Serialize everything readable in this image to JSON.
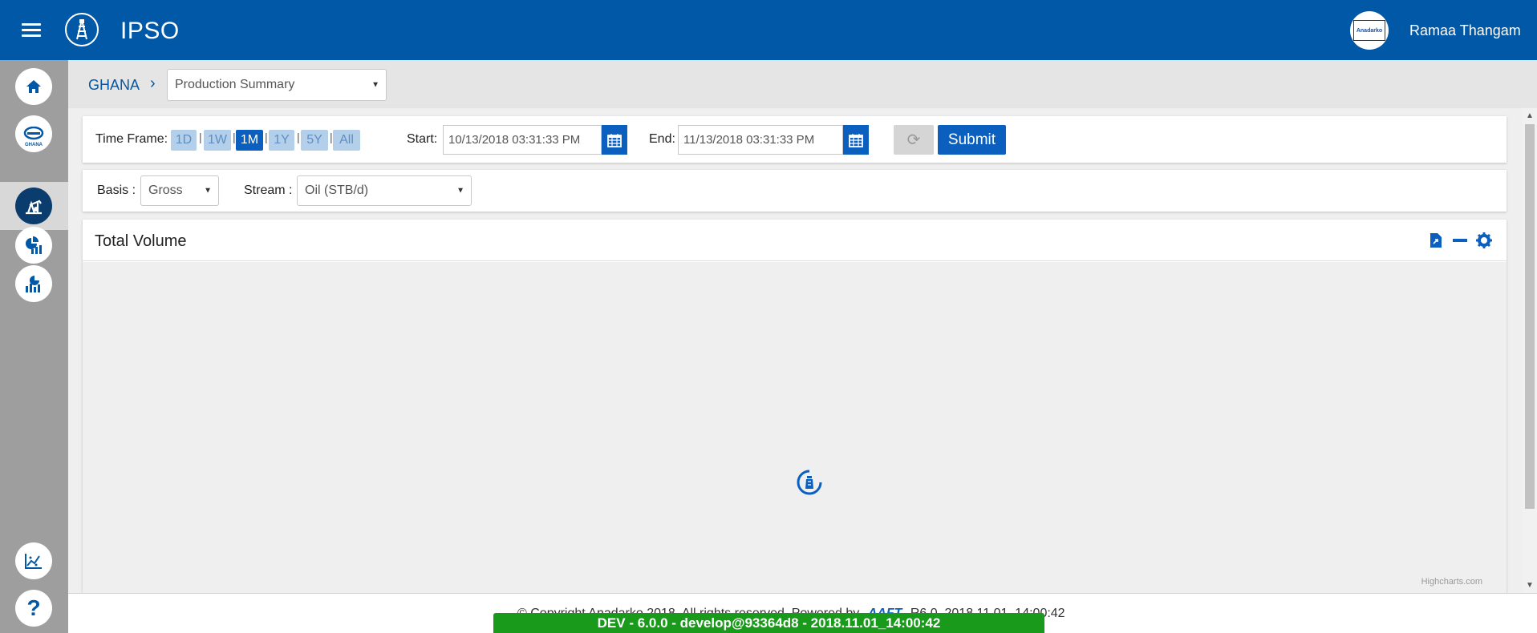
{
  "app": {
    "title": "IPSO",
    "user_name": "Ramaa Thangam",
    "avatar_text": "Anadarko"
  },
  "sidebar": {
    "items": [
      {
        "name": "home",
        "label": ""
      },
      {
        "name": "ghana",
        "label": "GHANA"
      },
      {
        "name": "production",
        "label": ""
      },
      {
        "name": "analytics",
        "label": ""
      },
      {
        "name": "reports",
        "label": ""
      }
    ],
    "bottom": [
      {
        "name": "trend-analysis"
      },
      {
        "name": "help",
        "label": "?"
      }
    ]
  },
  "breadcrumb": {
    "root": "GHANA",
    "separator": "›",
    "page_select": "Production Summary"
  },
  "filters": {
    "time_frame_label": "Time Frame:",
    "time_frames": [
      "1D",
      "1W",
      "1M",
      "1Y",
      "5Y",
      "All"
    ],
    "active_time_frame": "1M",
    "start_label": "Start:",
    "start_value": "10/13/2018 03:31:33 PM",
    "end_label": "End:",
    "end_value": "11/13/2018 03:31:33 PM",
    "submit_label": "Submit",
    "basis_label": "Basis :",
    "basis_value": "Gross",
    "stream_label": "Stream :",
    "stream_value": "Oil (STB/d)"
  },
  "chart": {
    "title": "Total Volume",
    "credit": "Highcharts.com"
  },
  "footer": {
    "copyright": "© Copyright Anadarko 2018. All rights reserved. Powered by",
    "brand": "AAFT",
    "build_suffix": "R6.0_2018.11.01_14:00:42",
    "env_banner": "DEV - 6.0.0 - develop@93364d8 - 2018.11.01_14:00:42"
  },
  "colors": {
    "primary": "#0158a6",
    "accent": "#0a5fbf",
    "env_green": "#1a9a1a"
  }
}
